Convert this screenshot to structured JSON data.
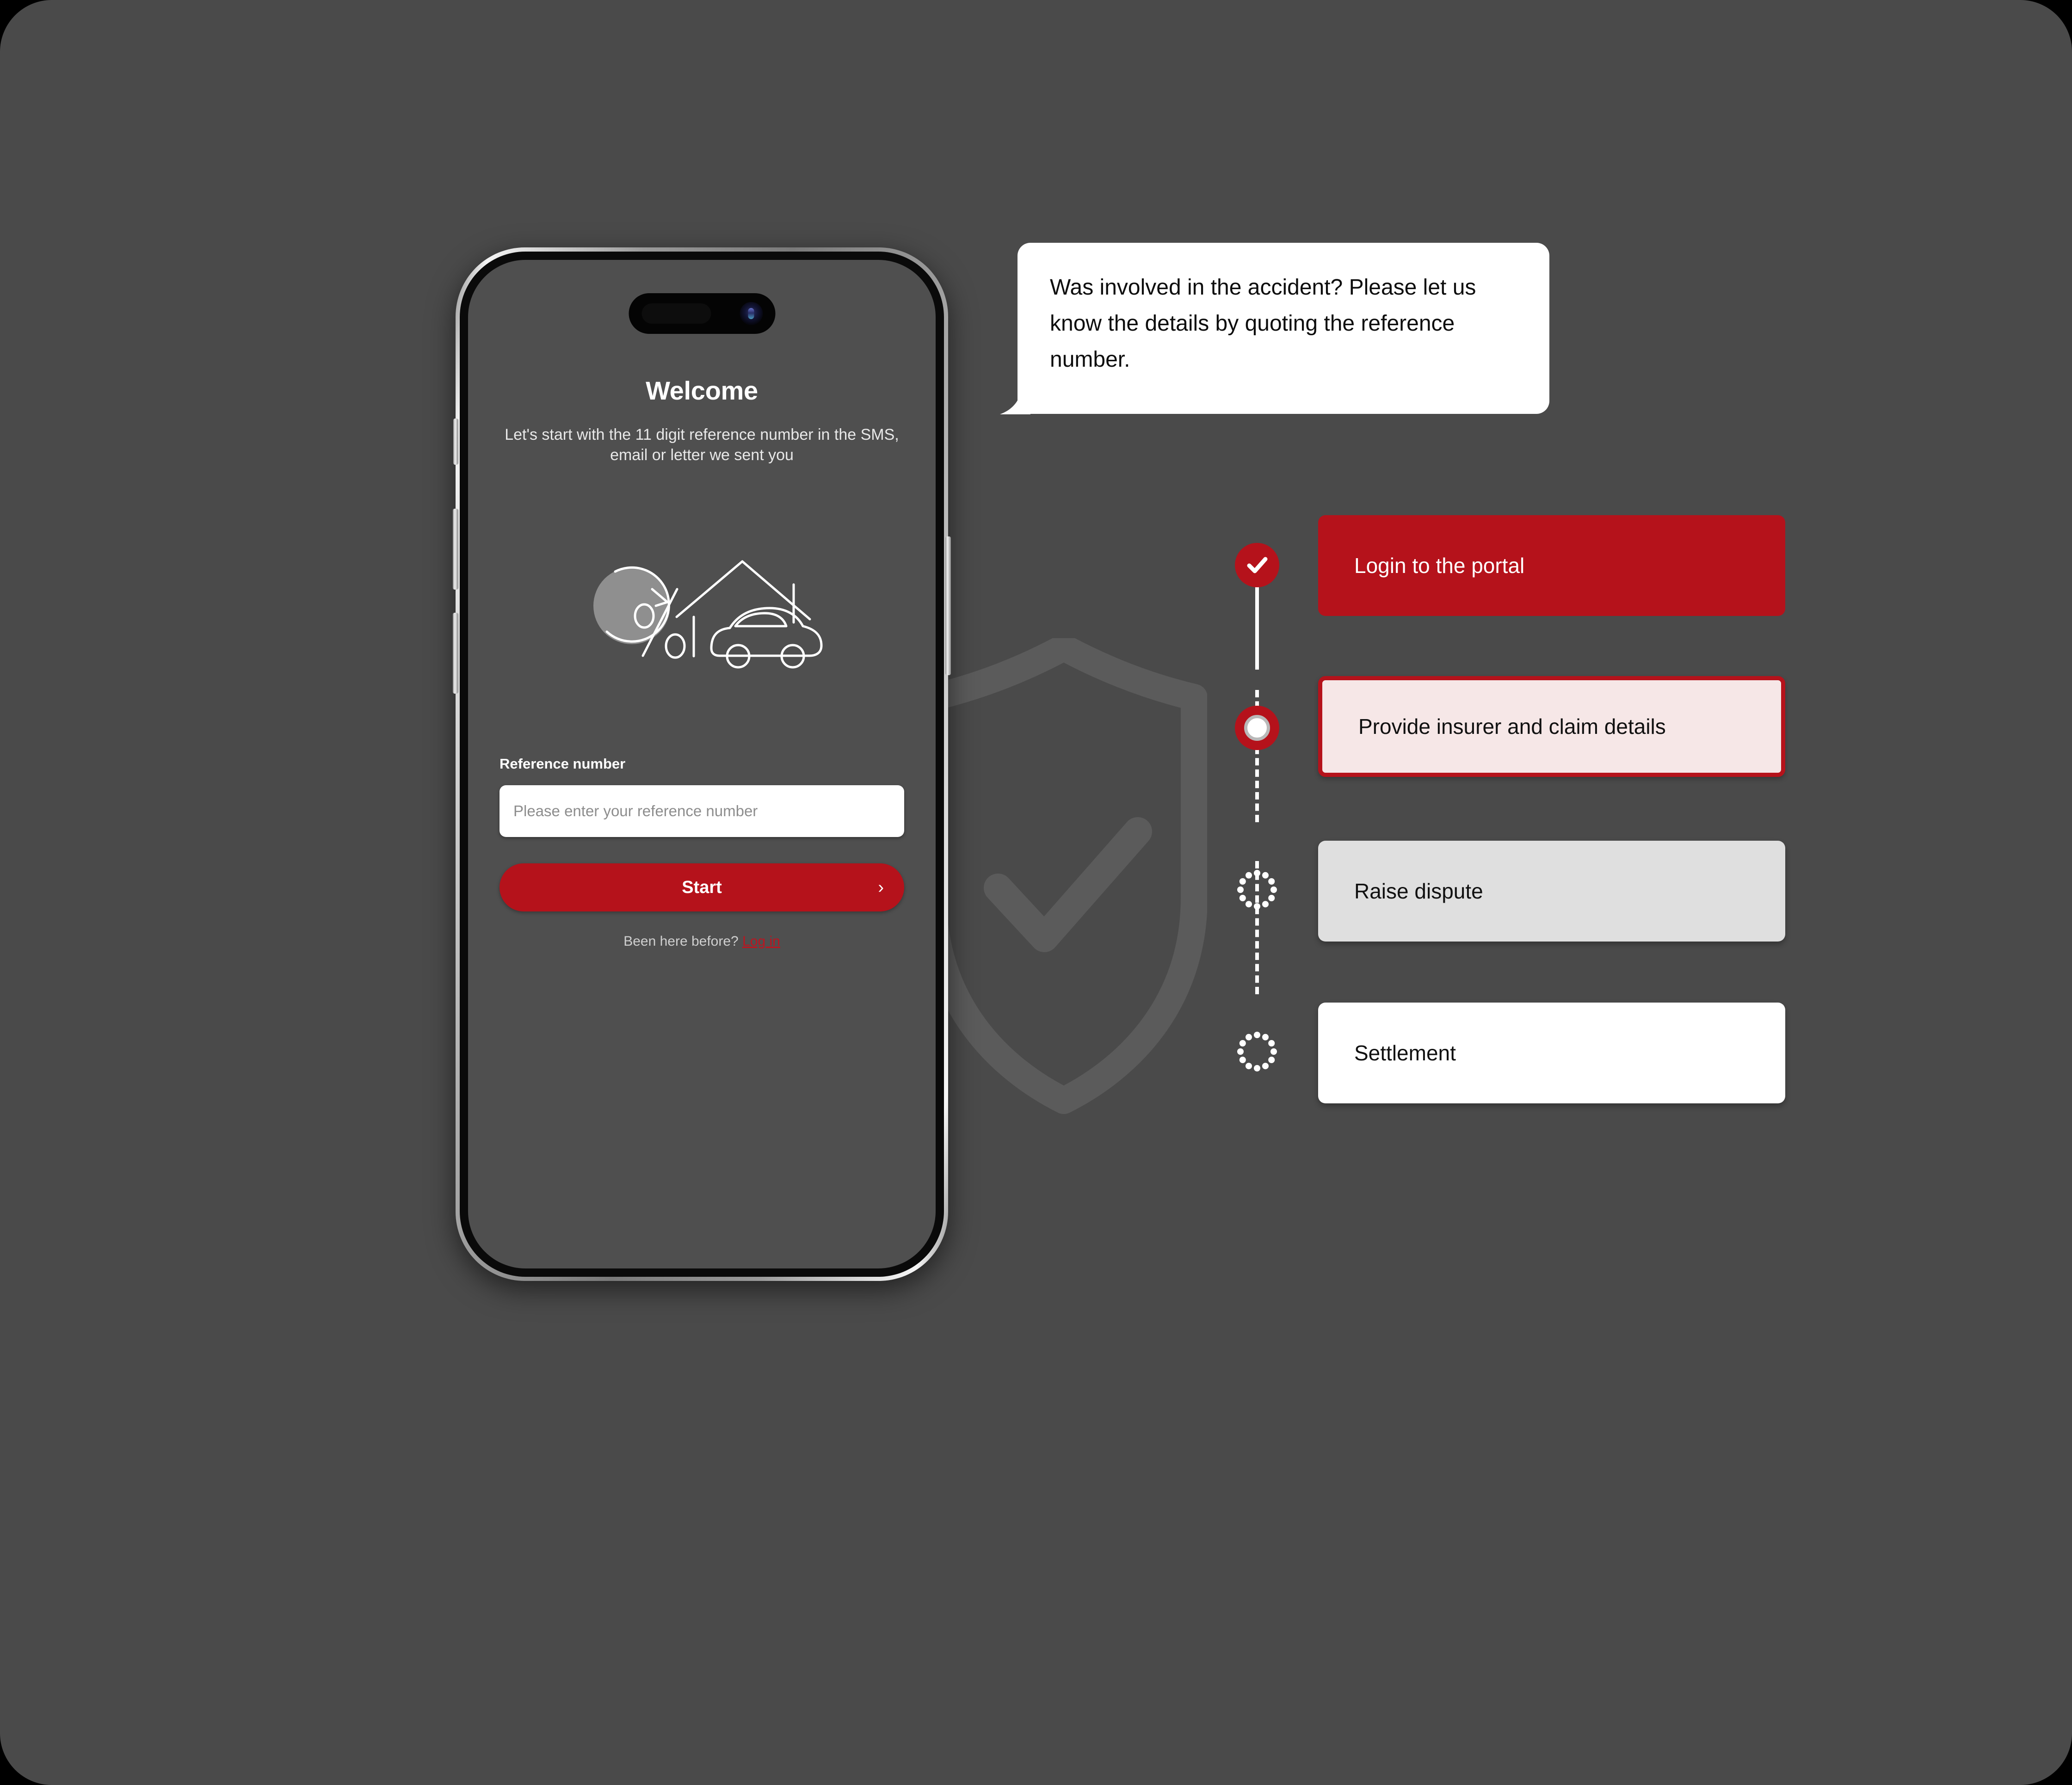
{
  "canvas": {
    "background": "#4a4a4a"
  },
  "phone": {
    "screen": {
      "title": "Welcome",
      "subtitle": "Let's start with the 11 digit reference number in the SMS, email or letter we sent you",
      "field_label": "Reference number",
      "input_value": "",
      "input_placeholder": "Please enter your reference number",
      "start_button": "Start",
      "start_chevron": "›",
      "footer_prefix": "Been here before? ",
      "footer_link": "Log in"
    },
    "hardware": {
      "mute_switch": "mute-switch",
      "volume_up": "volume-up-button",
      "volume_down": "volume-down-button",
      "power": "power-button",
      "dynamic_island": "dynamic-island",
      "camera": "front-camera"
    },
    "illustration": {
      "name": "percent-house-car-illustration",
      "elements": [
        "percent-sign",
        "circular-arrow",
        "house-roof",
        "car"
      ]
    }
  },
  "speech_bubble": {
    "text": "Was involved in the accident? Please let us know the details by quoting the reference number.",
    "background": "#ffffff",
    "text_color": "#0d0d0d"
  },
  "watermark": {
    "name": "shield-check-watermark",
    "color": "#5b5b5b"
  },
  "stepper": {
    "accent": "#b5121b",
    "steps": [
      {
        "label": "Login to the portal",
        "state": "completed",
        "marker": "check-icon",
        "box_bg": "#b5121b",
        "box_text": "#ffffff"
      },
      {
        "label": "Provide insurer and claim details",
        "state": "current",
        "marker": "ring-icon",
        "box_bg": "#f6e7e7",
        "box_text": "#111111"
      },
      {
        "label": "Raise dispute",
        "state": "pending",
        "marker": "dotted-circle-icon",
        "box_bg": "#dfdfdf",
        "box_text": "#111111"
      },
      {
        "label": "Settlement",
        "state": "pending",
        "marker": "dotted-circle-icon",
        "box_bg": "#ffffff",
        "box_text": "#111111"
      }
    ]
  }
}
